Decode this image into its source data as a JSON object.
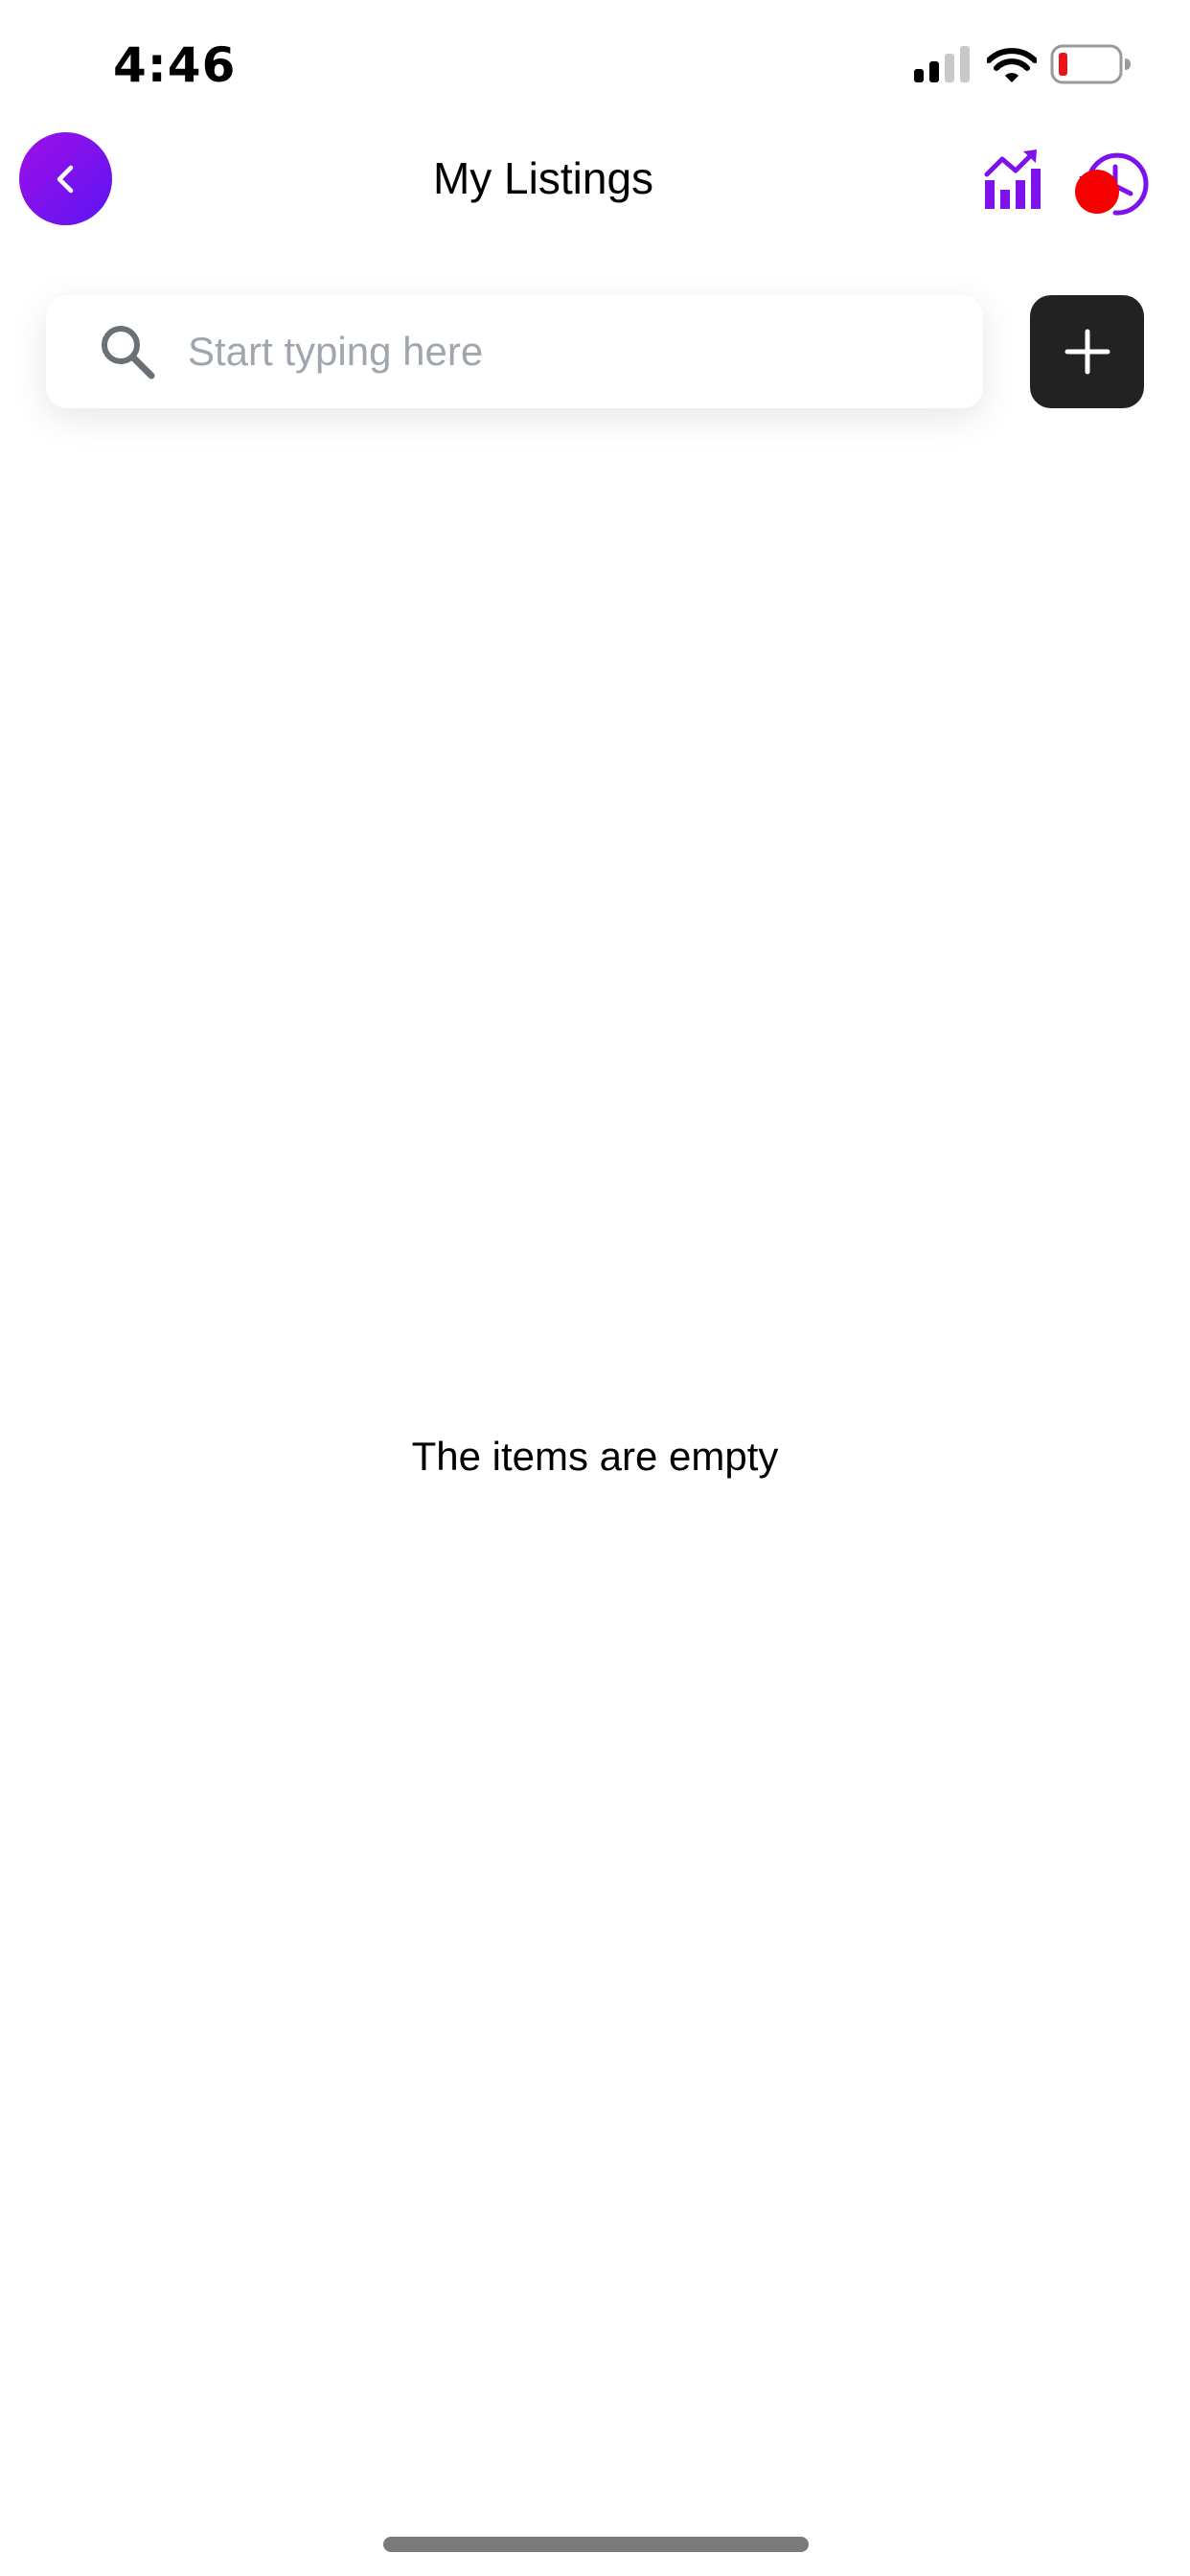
{
  "status_bar": {
    "time": "4:46",
    "icons": [
      "signal-icon",
      "wifi-icon",
      "battery-icon"
    ],
    "battery_level_color": "#e8141c"
  },
  "header": {
    "title": "My Listings",
    "back_icon": "chevron-left-icon",
    "actions": [
      "analytics-chart-icon",
      "history-clock-icon"
    ],
    "accent_gradient": [
      "#a00ee8",
      "#5b16f2"
    ],
    "icon_color": "#7e12ea",
    "notification_color": "#f70000"
  },
  "search": {
    "placeholder": "Start typing here",
    "value": "",
    "icon": "search-icon"
  },
  "add_button": {
    "icon": "plus-icon",
    "background": "#222222"
  },
  "content": {
    "empty_message": "The items are empty"
  }
}
